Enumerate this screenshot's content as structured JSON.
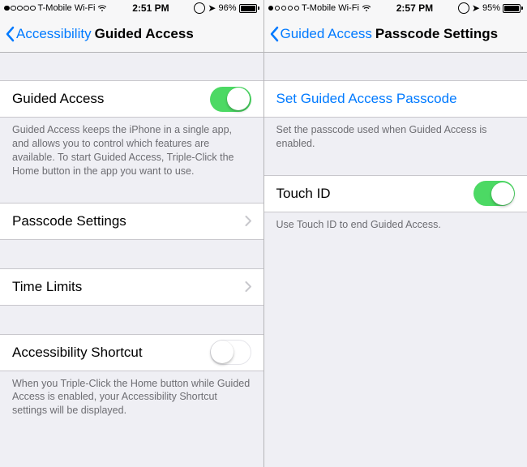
{
  "left": {
    "status": {
      "carrier": "T-Mobile Wi-Fi",
      "time": "2:51 PM",
      "battery_pct": "96%",
      "signal_filled": 1,
      "signal_total": 5,
      "battery_fill": 0.96
    },
    "nav": {
      "back": "Accessibility",
      "title": "Guided Access"
    },
    "rows": {
      "guided_access": {
        "label": "Guided Access",
        "on": true
      },
      "ga_footer": "Guided Access keeps the iPhone in a single app, and allows you to control which features are available. To start Guided Access, Triple-Click the Home button in the app you want to use.",
      "passcode": {
        "label": "Passcode Settings"
      },
      "time_limits": {
        "label": "Time Limits"
      },
      "shortcut": {
        "label": "Accessibility Shortcut",
        "on": false
      },
      "shortcut_footer": "When you Triple-Click the Home button while Guided Access is enabled, your Accessibility Shortcut settings will be displayed."
    }
  },
  "right": {
    "status": {
      "carrier": "T-Mobile Wi-Fi",
      "time": "2:57 PM",
      "battery_pct": "95%",
      "signal_filled": 1,
      "signal_total": 5,
      "battery_fill": 0.95
    },
    "nav": {
      "back": "Guided Access",
      "title": "Passcode Settings"
    },
    "rows": {
      "set_passcode": {
        "label": "Set Guided Access Passcode"
      },
      "set_footer": "Set the passcode used when Guided Access is enabled.",
      "touch_id": {
        "label": "Touch ID",
        "on": true
      },
      "touch_footer": "Use Touch ID to end Guided Access."
    }
  }
}
